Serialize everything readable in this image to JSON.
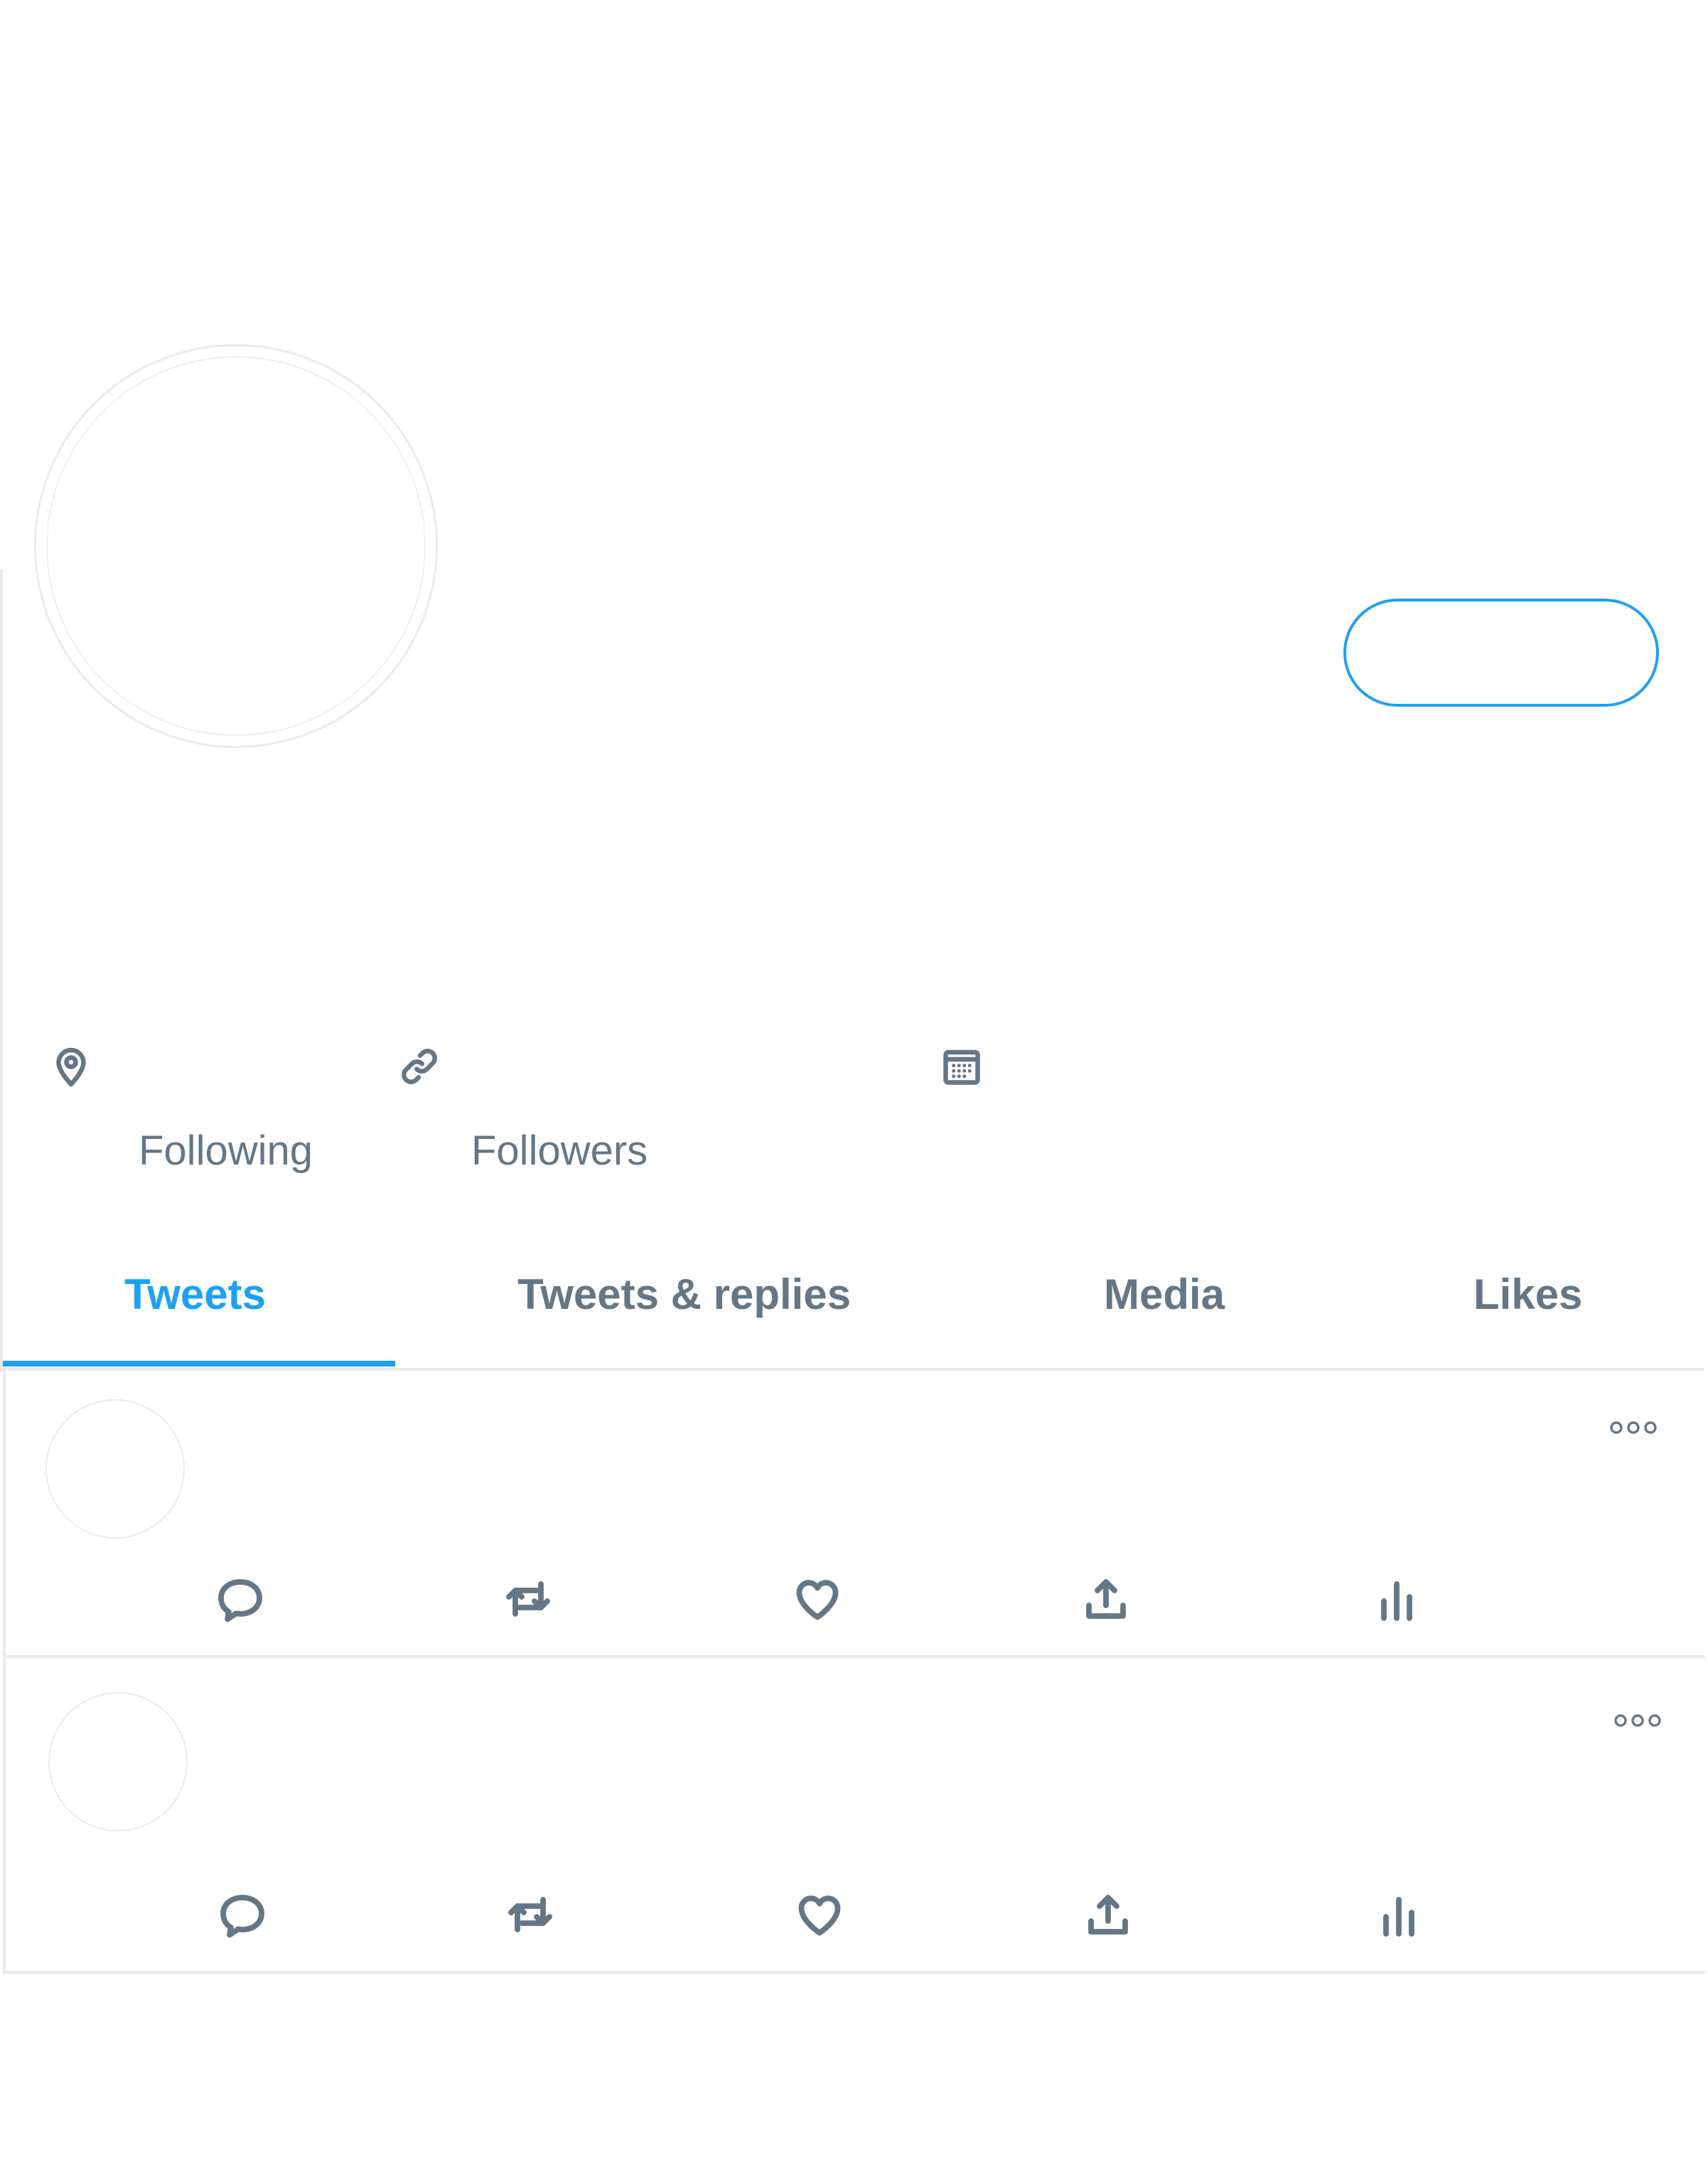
{
  "profile": {
    "header_icons": [
      "location-icon",
      "link-icon",
      "calendar-icon"
    ],
    "stats": {
      "following_label": "Following",
      "followers_label": "Followers"
    }
  },
  "tabs": [
    {
      "label": "Tweets",
      "active": true
    },
    {
      "label": "Tweets & replies",
      "active": false
    },
    {
      "label": "Media",
      "active": false
    },
    {
      "label": "Likes",
      "active": false
    }
  ],
  "tweets": [
    {
      "actions": [
        "reply-icon",
        "retweet-icon",
        "like-icon",
        "share-icon",
        "analytics-icon"
      ],
      "menu_icon": "more-icon"
    },
    {
      "actions": [
        "reply-icon",
        "retweet-icon",
        "like-icon",
        "share-icon",
        "analytics-icon"
      ],
      "menu_icon": "more-icon"
    }
  ],
  "colors": {
    "accent": "#1da1f2",
    "secondary_text": "#657786",
    "divider": "#e6ecf0"
  }
}
